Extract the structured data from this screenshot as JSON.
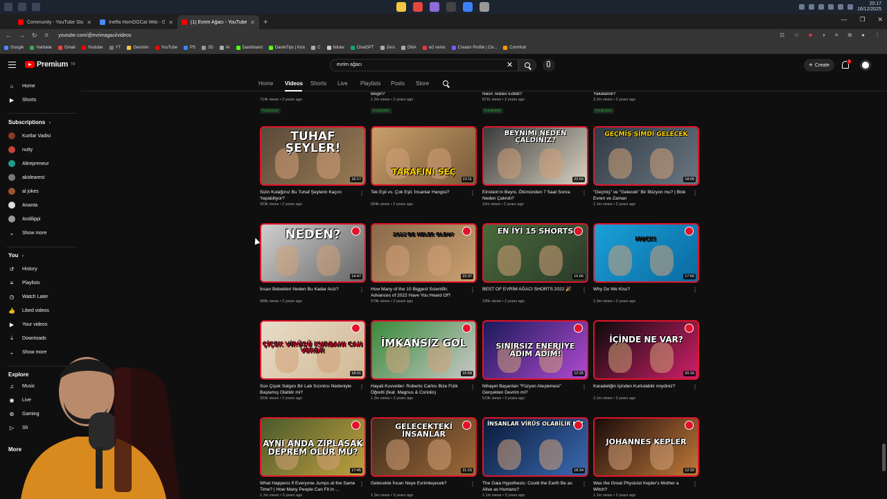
{
  "os": {
    "time": "20:17",
    "date": "16/12/2025"
  },
  "browser": {
    "tabs": [
      {
        "label": "Community - YouTube Studio"
      },
      {
        "label": "Ineffa HomDGCat Wiki - Gensh..."
      },
      {
        "label": "(1) Evrim Ağacı - YouTube"
      }
    ],
    "url": "youtube.com/@evrimagaci/videos",
    "bookmarks": [
      "Google",
      "Haritalar",
      "Gmail",
      "Youtube",
      "YT",
      "Genshin",
      "YouTube",
      "PS",
      "3D",
      "AI",
      "Dashboard",
      "DanteTips | Kick",
      "C",
      "tldraw",
      "ChatGPT",
      "Zero",
      "DNA",
      "w2 remix",
      "Creator Profile | Civ...",
      "ComHub"
    ]
  },
  "header": {
    "logo_text": "Premium",
    "logo_sup": "TR",
    "search_value": "evrim ağacı",
    "create_label": "Create",
    "notif_count": "1"
  },
  "sidebar": {
    "main": [
      {
        "label": "Home"
      },
      {
        "label": "Shorts"
      }
    ],
    "subscriptions_title": "Subscriptions",
    "subscriptions": [
      {
        "label": "Kurtlar Vadisi"
      },
      {
        "label": "nutty"
      },
      {
        "label": "Altrepreneur"
      },
      {
        "label": "akidearest"
      },
      {
        "label": "al jokes"
      },
      {
        "label": "Ananta"
      },
      {
        "label": "Andilippi"
      },
      {
        "label": "Show more"
      }
    ],
    "you_title": "You",
    "you": [
      {
        "label": "History"
      },
      {
        "label": "Playlists"
      },
      {
        "label": "Watch Later"
      },
      {
        "label": "Liked videos"
      },
      {
        "label": "Your videos"
      },
      {
        "label": "Downloads"
      },
      {
        "label": "Show more"
      }
    ],
    "explore_title": "Explore",
    "explore": [
      {
        "label": "Music"
      },
      {
        "label": "Live"
      },
      {
        "label": "Gaming"
      },
      {
        "label": "Sh"
      }
    ],
    "more_title": "More"
  },
  "channel_tabs": [
    "Home",
    "Videos",
    "Shorts",
    "Live",
    "Playlists",
    "Posts",
    "Store"
  ],
  "partial_row": [
    {
      "title": "",
      "meta": "714k views • 2 years ago",
      "tag": "Fundraiser"
    },
    {
      "title": "Begin?",
      "meta": "1.2m views • 2 years ago",
      "tag": "Fundraiser"
    },
    {
      "title": "Nasıl Tedavi Edildi?",
      "meta": "871k views • 2 years ago",
      "tag": "Fundraiser"
    },
    {
      "title": "Yakalandı?",
      "meta": "3.2m views • 2 years ago",
      "tag": "Fundraiser"
    }
  ],
  "videos": [
    {
      "thumb_text": "TUHAF ŞEYLER!",
      "duration": "16:17",
      "title": "Sizin Kulağınız Bu Tuhaf Şeylerin Kaçını Yapabiliyor?",
      "meta": "423k views • 2 years ago"
    },
    {
      "thumb_text": "TARAFINI SEÇ",
      "duration": "22:11",
      "title": "Tek Eşli vs. Çok Eşli: İnsanlar Hangisi?",
      "meta": "934k views • 2 years ago"
    },
    {
      "thumb_text": "BEYNİMİ NEDEN ÇALDINIZ?",
      "duration": "22:59",
      "title": "Einstein'ın Beyni, Ölümünden 7 Saat Sonra Neden Çalındı?",
      "meta": "10m views • 2 years ago"
    },
    {
      "thumb_text": "GEÇMİŞ ŞİMDİ GELECEK",
      "duration": "18:05",
      "title": "\"Geçmiş\" ve \"Gelecek\" Bir İllüzyon mu? | Blok Evren ve Zaman",
      "meta": "1.1m views • 2 years ago"
    },
    {
      "thumb_text": "NEDEN?",
      "duration": "14:47",
      "title": "İnsan Bebekleri Neden Bu Kadar Aciz?",
      "meta": "998k views • 2 years ago"
    },
    {
      "thumb_text": "2022'DE NELER OLDU?",
      "duration": "22:37",
      "title": "How Many of the 10 Biggest Scientific Advances of 2022 Have You Heard Of?",
      "meta": "579k views • 2 years ago"
    },
    {
      "thumb_text": "EN İYİ 15 SHORTS",
      "duration": "15:06",
      "title": "BEST OF EVRİM AĞACI SHORTS 2022 🎉",
      "meta": "195k views • 2 years ago"
    },
    {
      "thumb_text": "MUCK!",
      "duration": "17:50",
      "title": "Why Do We Kiss?",
      "meta": "1.3m views • 2 years ago"
    },
    {
      "thumb_text": "ÇİÇEK VİRÜSÜ KURBANI CAN VERDİ!",
      "duration": "18:01",
      "title": "Son Çiçek Salgını Bir Lab Sızıntısı Nedeniyle Başlamış Olabilir mi?",
      "meta": "353k views • 2 years ago"
    },
    {
      "thumb_text": "İMKANSIZ GOL",
      "duration": "15:58",
      "title": "Hayali Kuvvetler: Roberto Carlos Bize Fizik Öğretti (feat. Magnus & Coriolis)",
      "meta": "1.3m views • 2 years ago"
    },
    {
      "thumb_text": "SINIRSIZ ENERJİYE ADIM ADIM!",
      "duration": "12:25",
      "title": "Nihayet Başarılan \"Füzyon Ateşlemesi\" Gerçekten Devrim mi?",
      "meta": "519k views • 3 years ago"
    },
    {
      "thumb_text": "İÇİNDE NE VAR?",
      "duration": "20:16",
      "title": "Karadeliğin İçinden Kurtulabilir miydiniz?",
      "meta": "2.1m views • 3 years ago"
    },
    {
      "thumb_text": "AYNI ANDA ZIPLASAK DEPREM OLUR MU?",
      "duration": "17:45",
      "title": "What Happens If Everyone Jumps at the Same Time? | How Many People Can Fit in ...",
      "meta": "1.1m views • 3 years ago"
    },
    {
      "thumb_text": "GELECEKTEKİ İNSANLAR",
      "duration": "21:15",
      "title": "Gelecekte İnsan Neye Evrimleşecek?",
      "meta": "1.3m views • 3 years ago"
    },
    {
      "thumb_text": "İNSANLAR VİRÜS OLABİLİR Mİ?",
      "duration": "18:34",
      "title": "The Gaia Hypothesis: Could the Earth Be as Alive as Humans?",
      "meta": "1.1m views • 3 years ago"
    },
    {
      "thumb_text": "JOHANNES KEPLER",
      "duration": "12:32",
      "title": "Was the Great Physicist Kepler's Mother a Witch?",
      "meta": "1.1m views • 3 years ago"
    }
  ]
}
